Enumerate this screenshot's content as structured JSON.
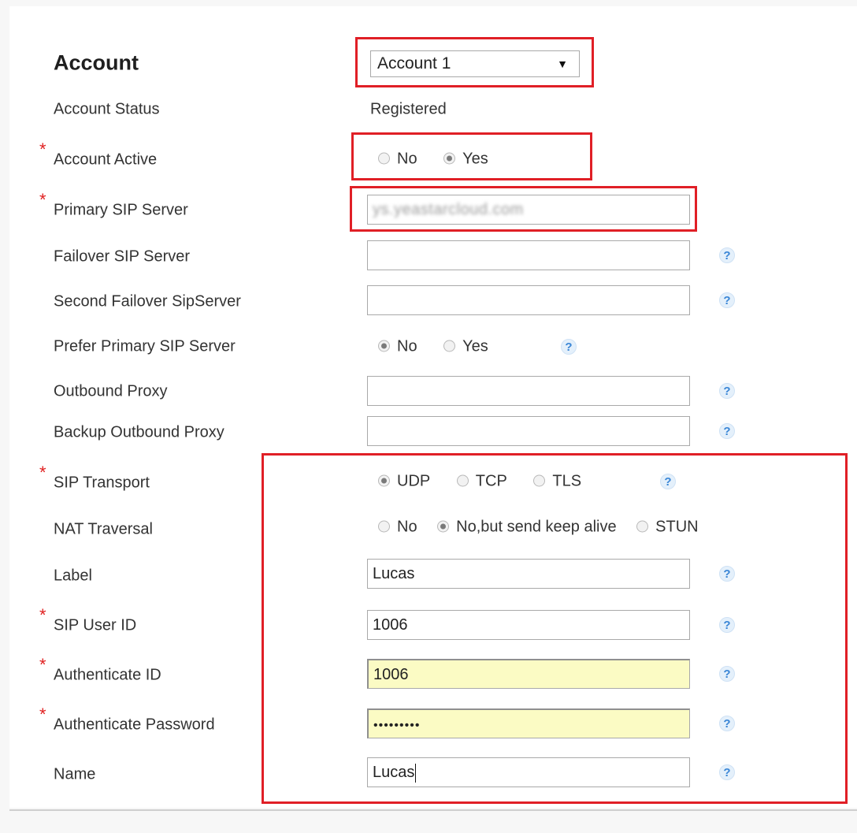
{
  "account": {
    "title": "Account",
    "selected": "Account 1"
  },
  "rows": {
    "account_status": {
      "label": "Account Status",
      "value": "Registered"
    },
    "account_active": {
      "label": "Account Active",
      "options": [
        "No",
        "Yes"
      ],
      "selected": "Yes"
    },
    "primary_sip_server": {
      "label": "Primary SIP Server",
      "value": "ys.yeastarcloud.com"
    },
    "failover_sip_server": {
      "label": "Failover SIP Server",
      "value": ""
    },
    "second_failover": {
      "label": "Second Failover SipServer",
      "value": ""
    },
    "prefer_primary": {
      "label": "Prefer Primary SIP Server",
      "options": [
        "No",
        "Yes"
      ],
      "selected": "No"
    },
    "outbound_proxy": {
      "label": "Outbound Proxy",
      "value": ""
    },
    "backup_outbound_proxy": {
      "label": "Backup Outbound Proxy",
      "value": ""
    },
    "sip_transport": {
      "label": "SIP Transport",
      "options": [
        "UDP",
        "TCP",
        "TLS"
      ],
      "selected": "UDP"
    },
    "nat_traversal": {
      "label": "NAT Traversal",
      "options": [
        "No",
        "No,but send keep alive",
        "STUN"
      ],
      "selected": "No,but send keep alive"
    },
    "label": {
      "label": "Label",
      "value": "Lucas"
    },
    "sip_user_id": {
      "label": "SIP User ID",
      "value": "1006"
    },
    "authenticate_id": {
      "label": "Authenticate ID",
      "value": "1006"
    },
    "authenticate_password": {
      "label": "Authenticate Password",
      "value": "•••••••••"
    },
    "name": {
      "label": "Name",
      "value": "Lucas"
    }
  },
  "required_marker": "*",
  "help_glyph": "?",
  "dropdown_arrow": "▼",
  "colors": {
    "required": "#e02020",
    "highlight": "#e01f26",
    "autofill": "#fbfbc4",
    "help": "#3a86d6"
  },
  "icons": {
    "help": "help-icon",
    "dropdown": "chevron-down-icon"
  }
}
